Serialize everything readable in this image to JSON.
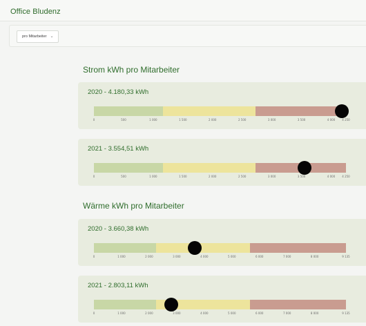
{
  "app": {
    "title": "Office Bludenz"
  },
  "toolbar": {
    "select_value": "pro Mitarbeiter",
    "select_icon": "chevron-down-icon"
  },
  "colors": {
    "green": "#c8d7a6",
    "yellow": "#ede49c",
    "red": "#c99c90",
    "marker": "#050505",
    "title": "#2f6d2c"
  },
  "sections": [
    {
      "title": "Strom kWh pro Mitarbeiter",
      "cards": [
        {
          "title": "2020 - 4.180,33 kWh",
          "value": 4180.33,
          "min": 0,
          "max": 4250,
          "green_until": 1170,
          "yellow_until": 2720,
          "ticks": [
            {
              "v": 0,
              "label": "0"
            },
            {
              "v": 500,
              "label": "500"
            },
            {
              "v": 1000,
              "label": "1 000"
            },
            {
              "v": 1500,
              "label": "1 500"
            },
            {
              "v": 2000,
              "label": "2 000"
            },
            {
              "v": 2500,
              "label": "2 500"
            },
            {
              "v": 3000,
              "label": "3 000"
            },
            {
              "v": 3500,
              "label": "3 500"
            },
            {
              "v": 4000,
              "label": "4 000"
            },
            {
              "v": 4250,
              "label": "4 250"
            }
          ]
        },
        {
          "title": "2021 - 3.554,51 kWh",
          "value": 3554.51,
          "min": 0,
          "max": 4250,
          "green_until": 1170,
          "yellow_until": 2720,
          "ticks": [
            {
              "v": 0,
              "label": "0"
            },
            {
              "v": 500,
              "label": "500"
            },
            {
              "v": 1000,
              "label": "1 000"
            },
            {
              "v": 1500,
              "label": "1 500"
            },
            {
              "v": 2000,
              "label": "2 000"
            },
            {
              "v": 2500,
              "label": "2 500"
            },
            {
              "v": 3000,
              "label": "3 000"
            },
            {
              "v": 3500,
              "label": "3 500"
            },
            {
              "v": 4000,
              "label": "4 000"
            },
            {
              "v": 4250,
              "label": "4 250"
            }
          ]
        }
      ]
    },
    {
      "title": "Wärme kWh pro Mitarbeiter",
      "cards": [
        {
          "title": "2020 - 3.660,38 kWh",
          "value": 3660.38,
          "min": 0,
          "max": 9135,
          "green_until": 2250,
          "yellow_until": 5660,
          "ticks": [
            {
              "v": 0,
              "label": "0"
            },
            {
              "v": 1000,
              "label": "1 000"
            },
            {
              "v": 2000,
              "label": "2 000"
            },
            {
              "v": 3000,
              "label": "3 000"
            },
            {
              "v": 4000,
              "label": "4 000"
            },
            {
              "v": 5000,
              "label": "5 000"
            },
            {
              "v": 6000,
              "label": "6 000"
            },
            {
              "v": 7000,
              "label": "7 000"
            },
            {
              "v": 8000,
              "label": "8 000"
            },
            {
              "v": 9135,
              "label": "9 135"
            }
          ]
        },
        {
          "title": "2021 - 2.803,11 kWh",
          "value": 2803.11,
          "min": 0,
          "max": 9135,
          "green_until": 2250,
          "yellow_until": 5660,
          "ticks": [
            {
              "v": 0,
              "label": "0"
            },
            {
              "v": 1000,
              "label": "1 000"
            },
            {
              "v": 2000,
              "label": "2 000"
            },
            {
              "v": 3000,
              "label": "3 000"
            },
            {
              "v": 4000,
              "label": "4 000"
            },
            {
              "v": 5000,
              "label": "5 000"
            },
            {
              "v": 6000,
              "label": "6 000"
            },
            {
              "v": 7000,
              "label": "7 000"
            },
            {
              "v": 8000,
              "label": "8 000"
            },
            {
              "v": 9135,
              "label": "9 135"
            }
          ]
        }
      ]
    }
  ]
}
